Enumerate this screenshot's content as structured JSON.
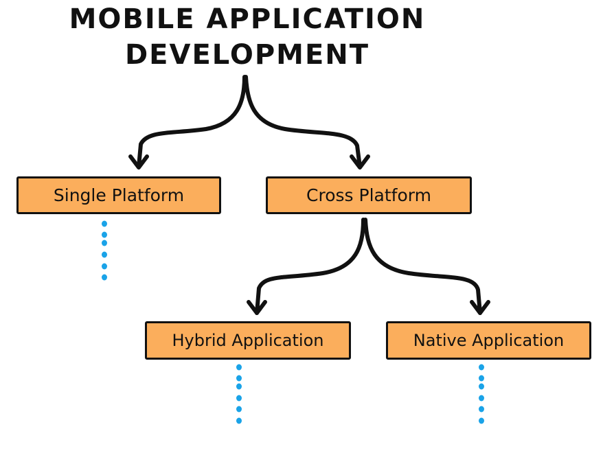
{
  "title": {
    "line1": "MOBILE APPLICATION",
    "line2": "DEVELOPMENT"
  },
  "nodes": {
    "single_platform": "Single Platform",
    "cross_platform": "Cross Platform",
    "hybrid_application": "Hybrid Application",
    "native_application": "Native Application"
  },
  "edges": [
    {
      "from": "MOBILE APPLICATION DEVELOPMENT",
      "to": "Single Platform"
    },
    {
      "from": "MOBILE APPLICATION DEVELOPMENT",
      "to": "Cross Platform"
    },
    {
      "from": "Cross Platform",
      "to": "Hybrid Application"
    },
    {
      "from": "Cross Platform",
      "to": "Native Application"
    }
  ],
  "continuation_markers": [
    "Single Platform",
    "Hybrid Application",
    "Native Application"
  ],
  "colors": {
    "box_fill": "#fbae5c",
    "box_border": "#111111",
    "dots": "#1aa3e8",
    "text": "#111111"
  }
}
